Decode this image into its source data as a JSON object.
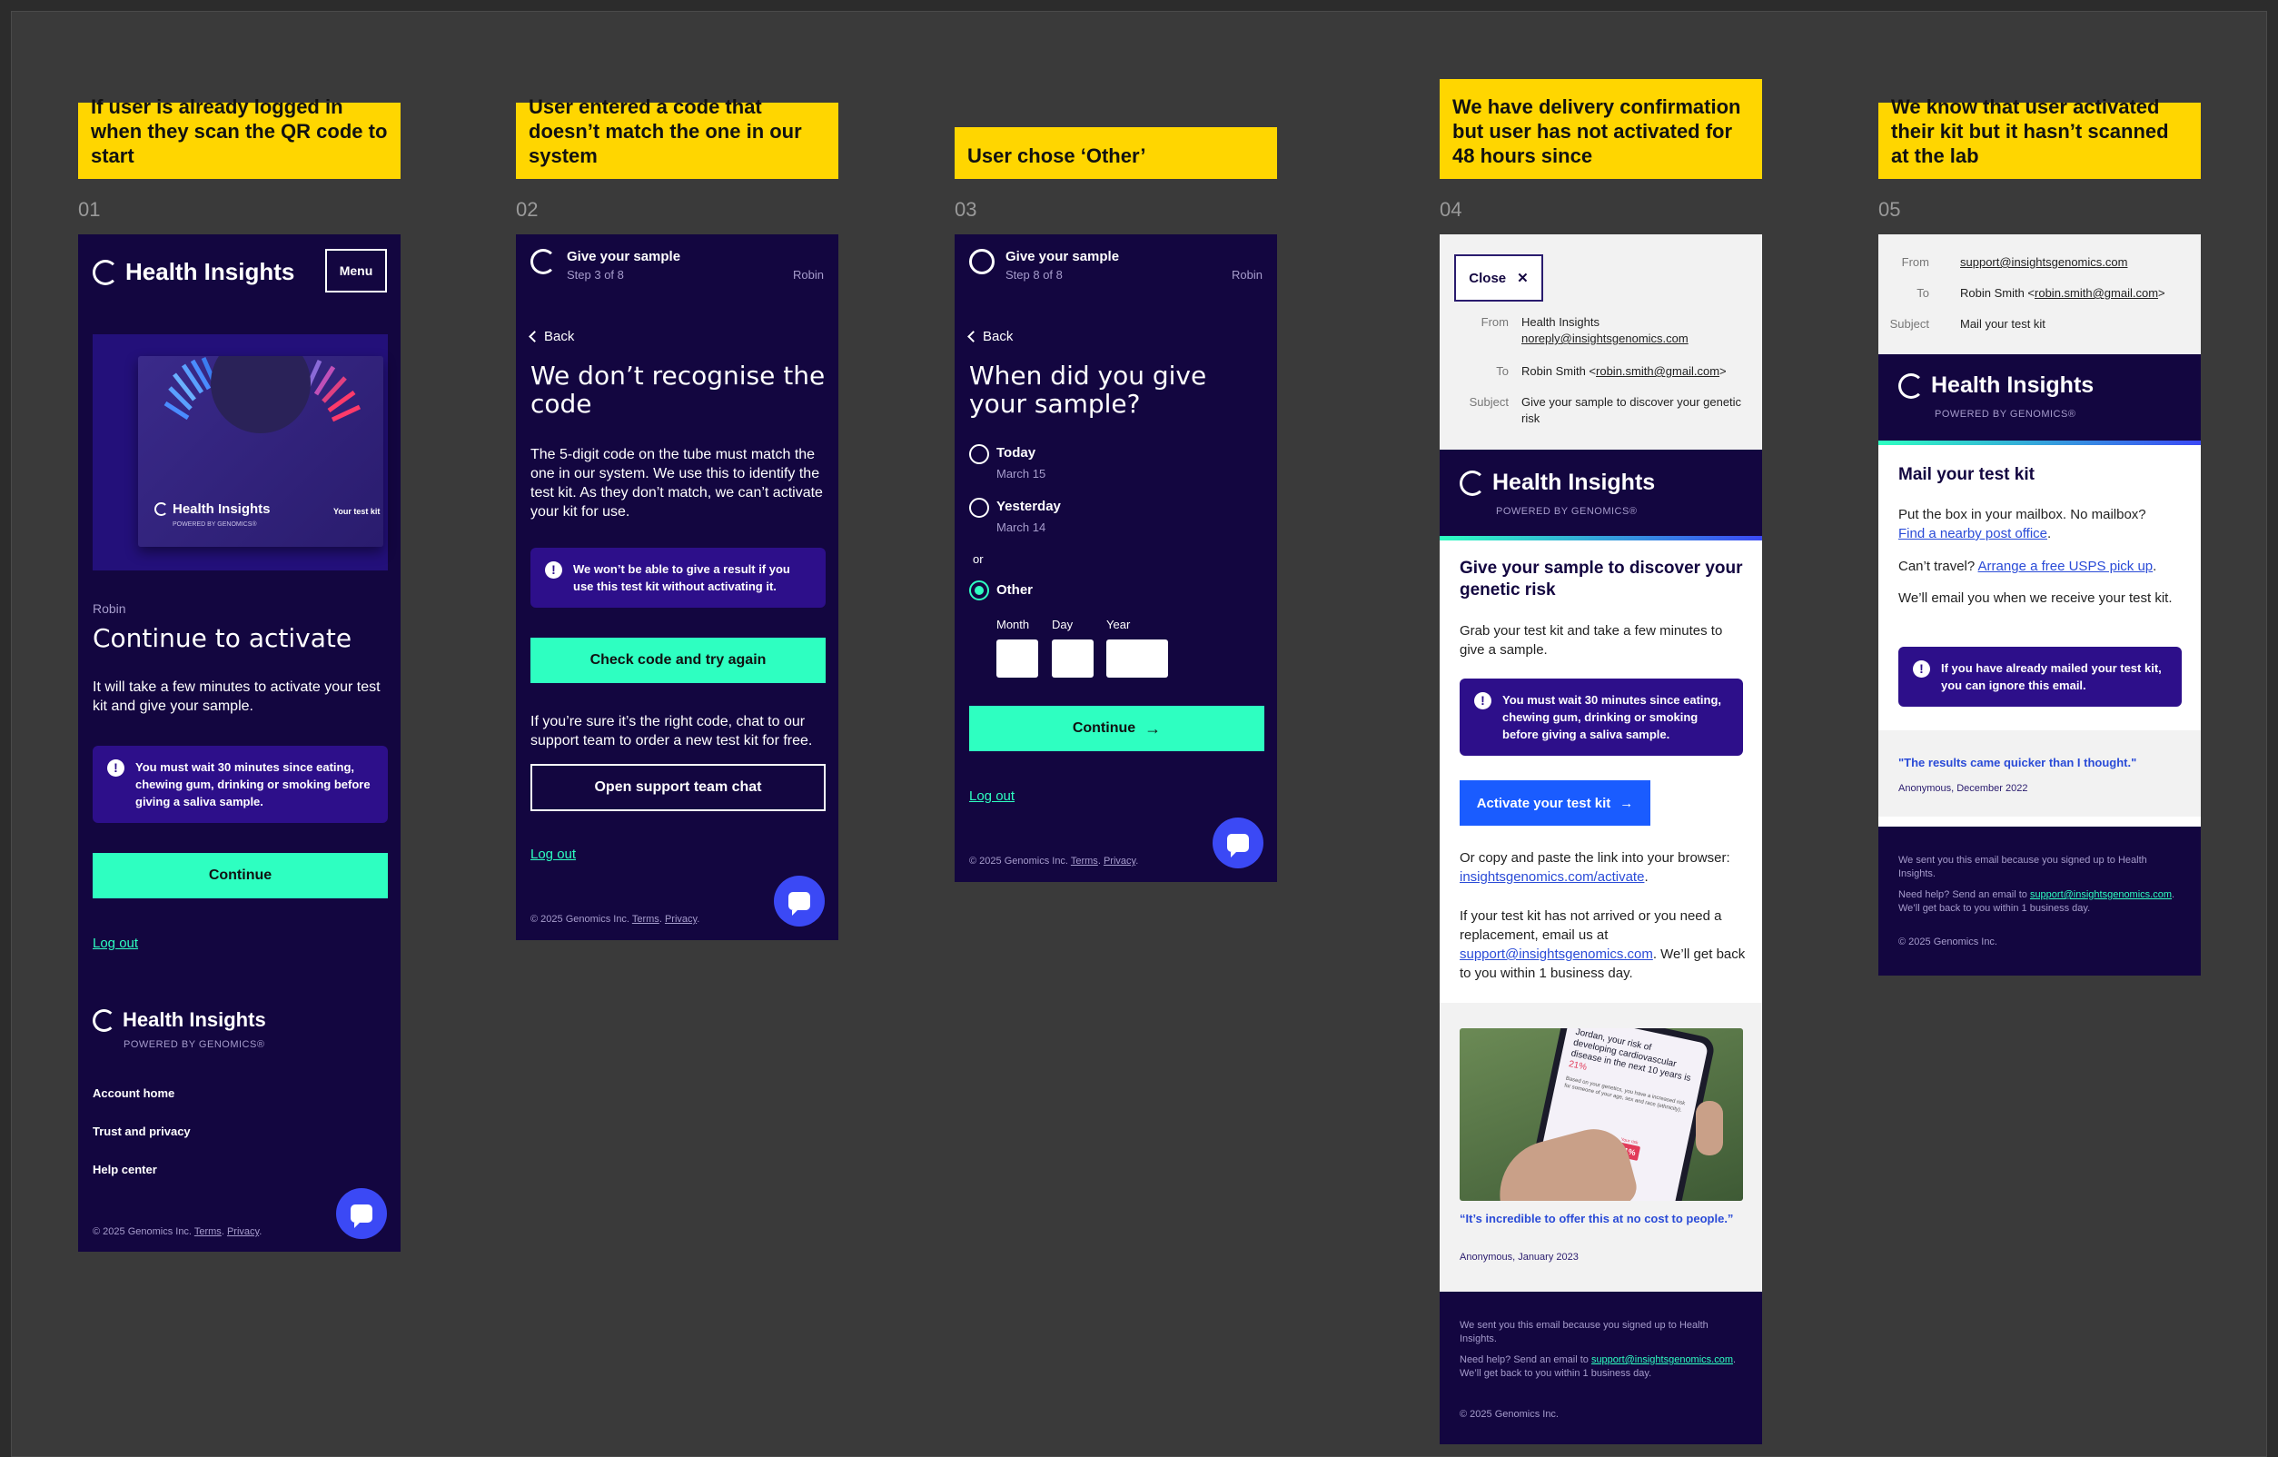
{
  "labels": {
    "s1": "If user is already logged in when they scan the QR code to start",
    "s2": "User entered a code that doesn’t match the one in our system",
    "s3": "User chose ‘Other’",
    "s4": "We have delivery confirmation but user has not activated for 48 hours since",
    "s5": "We know that user activated their kit but it hasn’t scanned at the lab"
  },
  "numbers": [
    "01",
    "02",
    "03",
    "04",
    "05"
  ],
  "brand": {
    "name": "Health Insights",
    "powered": "POWERED BY GENOMICS",
    "reg": "®"
  },
  "footer": {
    "copy": "© 2025 Genomics Inc.",
    "terms": "Terms",
    "privacy": "Privacy",
    "sep": ".",
    "end": "."
  },
  "screen1": {
    "menu": "Menu",
    "kit_label": "Your test kit",
    "user": "Robin",
    "title": "Continue to activate",
    "body": "It will take a few minutes to activate your test kit and give your sample.",
    "alert": "You must wait 30 minutes since eating, chewing gum, drinking or smoking before giving a saliva sample.",
    "continue": "Continue",
    "logout": "Log out",
    "links": [
      "Account home",
      "Trust and privacy",
      "Help center"
    ]
  },
  "screen2": {
    "step_title": "Give your sample",
    "step": "Step 3 of 8",
    "user": "Robin",
    "back": "Back",
    "title": "We don’t recognise the code",
    "body": "The 5-digit code on the tube must match the one in our system. We use this to identify the test kit. As they don’t match, we can’t activate your kit for use.",
    "alert": "We won’t be able to give a result if you use this test kit without activating it.",
    "check": "Check code and try again",
    "body2": "If you’re sure it’s the right code, chat to our support team to order a new test kit for free.",
    "chat_btn": "Open support team chat",
    "logout": "Log out"
  },
  "screen3": {
    "step_title": "Give your sample",
    "step": "Step 8 of 8",
    "user": "Robin",
    "back": "Back",
    "title": "When did you give your sample?",
    "options": [
      {
        "label": "Today",
        "sub": "March 15"
      },
      {
        "label": "Yesterday",
        "sub": "March 14"
      }
    ],
    "or": "or",
    "other": "Other",
    "month": "Month",
    "day": "Day",
    "year": "Year",
    "continue": "Continue",
    "logout": "Log out"
  },
  "email4": {
    "close": "Close",
    "from_k": "From",
    "from_name": "Health Insights",
    "from_addr": "noreply@insightsgenomics.com",
    "to_k": "To",
    "to_name": "Robin Smith <",
    "to_addr": "robin.smith@gmail.com",
    "to_end": ">",
    "subject_k": "Subject",
    "subject": "Give your sample to discover your genetic risk",
    "heading": "Give your sample to discover your genetic risk",
    "p1": "Grab your test kit and take a few minutes to give a sample.",
    "alert": "You must wait 30 minutes since eating, chewing gum, drinking or smoking before giving a saliva sample.",
    "cta": "Activate your test kit",
    "p2a": "Or copy and paste the link into your browser: ",
    "p2link": "insightsgenomics.com/activate",
    "p2b": ".",
    "p3a": "If your test kit has not arrived or you need a replacement, email us at ",
    "p3link": "support@insightsgenomics.com",
    "p3b": ". We’ll get back to you within 1 business day.",
    "phone_text": "Jordan, your risk of developing cardiovascular disease in the next 10 years is ",
    "phone_pct": "21%",
    "phone_small": "Based on your genetics, you have a increased risk for someone of your age, sex and race (ethnicity).",
    "phone_badge": "21%",
    "phone_badge_label": "Your risk",
    "quote": "“It’s incredible to offer this at no cost to people.”",
    "attrib": "Anonymous, January 2023",
    "f1": "We sent you this email because you signed up to Health Insights.",
    "f2a": "Need help? Send an email to ",
    "f2link": "support@insightsgenomics.com",
    "f2b": ". We’ll get back to you within 1 business day.",
    "f3": "© 2025 Genomics Inc."
  },
  "email5": {
    "from_k": "From",
    "from_addr": "support@insightsgenomics.com",
    "to_k": "To",
    "to_name": "Robin Smith <",
    "to_addr": "robin.smith@gmail.com",
    "to_end": ">",
    "subject_k": "Subject",
    "subject": "Mail your test kit",
    "heading": "Mail your test kit",
    "p1": "Put the box in your mailbox. No mailbox?",
    "p1link": "Find a nearby post office",
    "p1end": ".",
    "p2": "Can’t travel? ",
    "p2link": "Arrange a free USPS pick up",
    "p2end": ".",
    "p3": "We’ll email you when we receive your test kit.",
    "alert": "If you have already mailed your test kit, you can ignore this email.",
    "quote": "\"The results came quicker than I thought.\"",
    "attrib": "Anonymous, December 2022",
    "f1": "We sent you this email because you signed up to Health Insights.",
    "f2a": "Need help? Send an email to ",
    "f2link": "support@insightsgenomics.com",
    "f2b": ". We’ll get back to you within 1 business day.",
    "f3": "© 2025 Genomics Inc."
  },
  "colors": {
    "navy": "#130640",
    "teal": "#2effc1",
    "yellow": "#ffd600",
    "blue": "#1a5cff",
    "alert": "#2d0f8a"
  }
}
